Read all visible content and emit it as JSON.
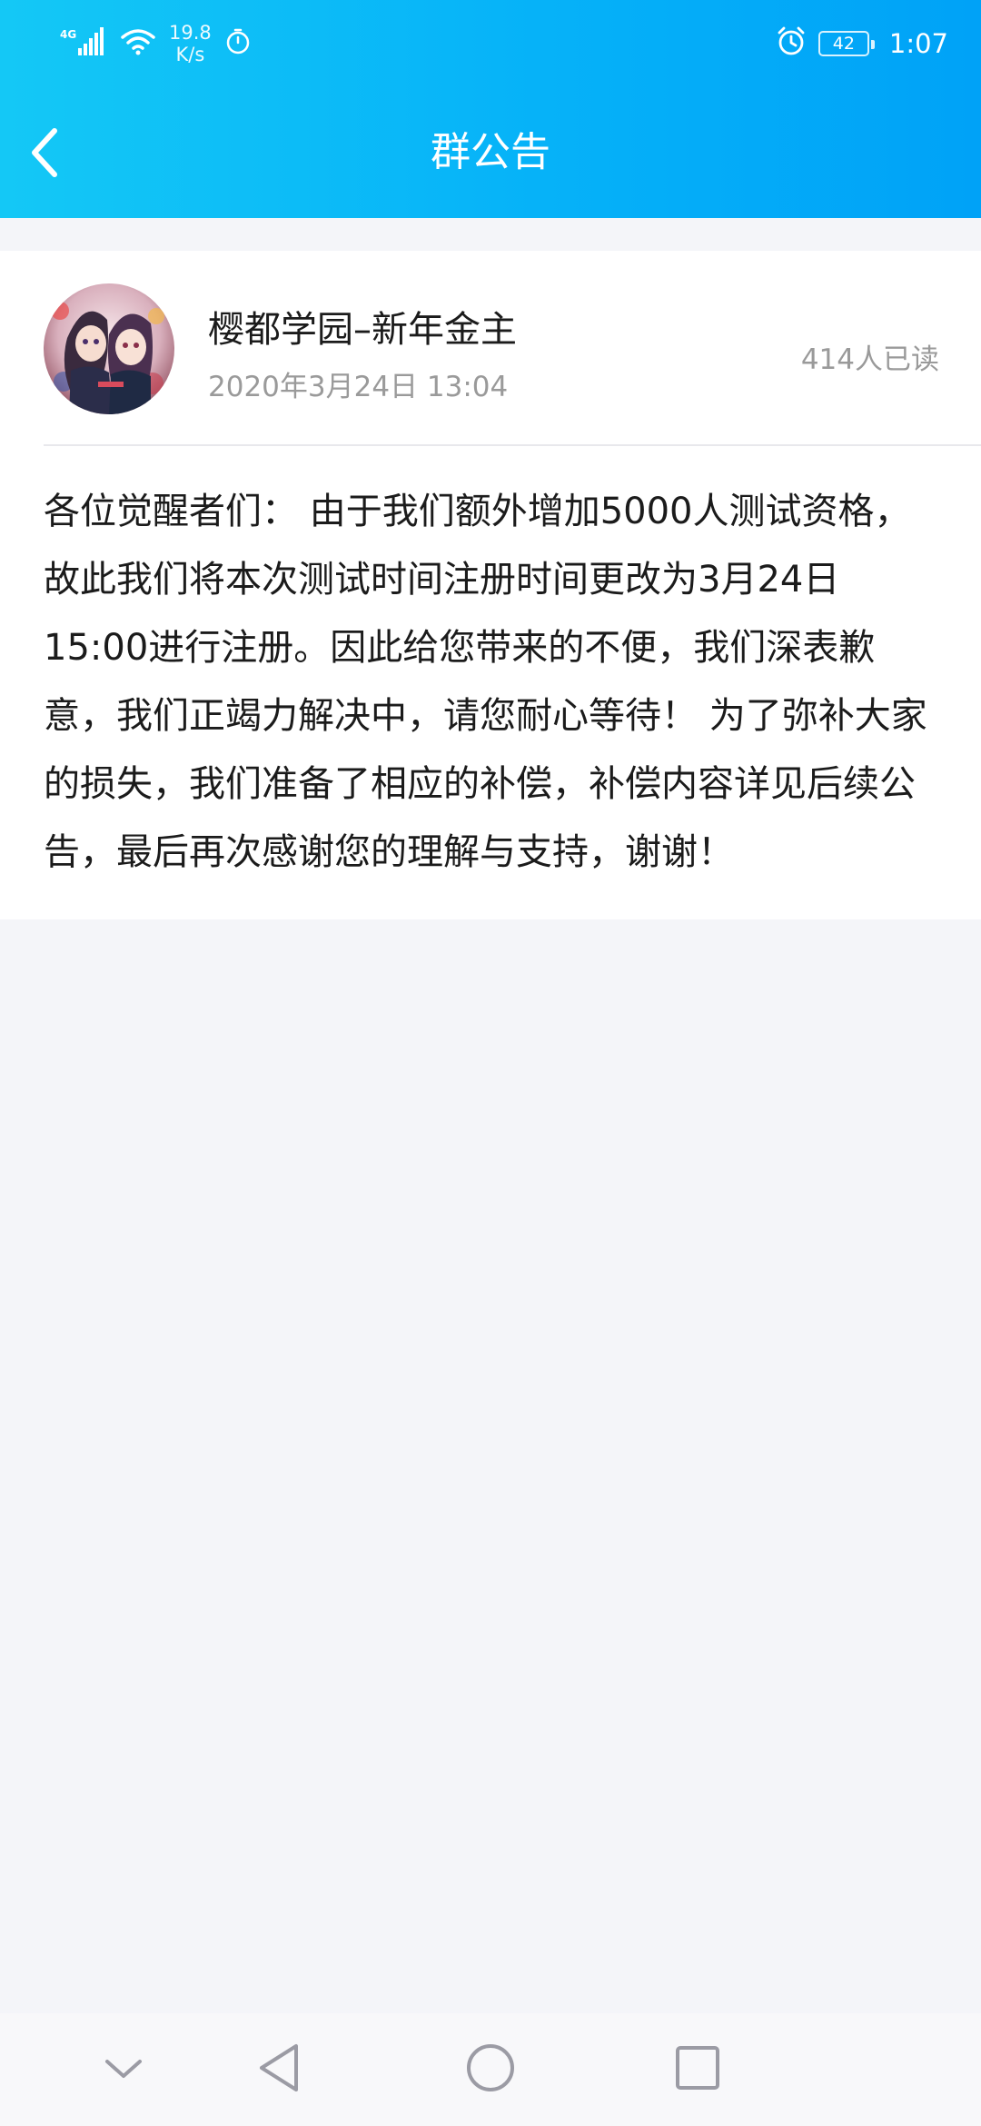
{
  "status_bar": {
    "network": "4G",
    "speed_value": "19.8",
    "speed_unit": "K/s",
    "time": "1:07",
    "battery": "42",
    "icons": [
      "signal-icon",
      "wifi-icon",
      "timer-icon",
      "alarm-icon",
      "battery-icon"
    ]
  },
  "header": {
    "title": "群公告",
    "back_icon": "chevron-left-icon"
  },
  "announcement": {
    "group_name": "樱都学园–新年金主",
    "timestamp": "2020年3月24日 13:04",
    "read_count": "414人已读",
    "body": "各位觉醒者们： 由于我们额外增加5000人测试资格，故此我们将本次测试时间注册时间更改为3月24日15:00进行注册。因此给您带来的不便，我们深表歉意，我们正竭力解决中，请您耐心等待！ 为了弥补大家的损失，我们准备了相应的补偿，补偿内容详见后续公告，最后再次感谢您的理解与支持，谢谢！"
  },
  "navbar": {
    "buttons": [
      "chevron-down-icon",
      "back-triangle-icon",
      "home-circle-icon",
      "recents-square-icon"
    ]
  },
  "colors": {
    "header_start": "#14c8f6",
    "header_end": "#00a2f7",
    "background": "#f4f5f9",
    "card": "#ffffff",
    "secondary_text": "#9a9a9a"
  }
}
